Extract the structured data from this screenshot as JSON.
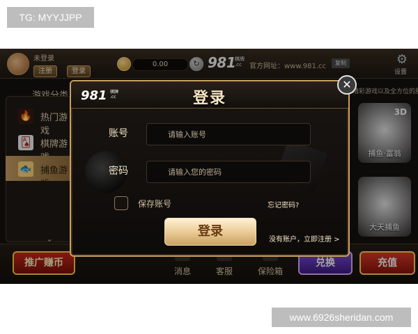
{
  "watermarks": {
    "top": "TG: MYYJJPP",
    "bottom": "www.6926sheridan.com"
  },
  "header": {
    "user_status": "未登录",
    "register_label": "注册",
    "login_label": "登录",
    "balance": "0.00",
    "refresh_symbol": "↻",
    "brand": "981",
    "brand_sub": "棋牌\n.cc",
    "site_label": "官方网址：www.981.cc",
    "copy_label": "复制",
    "settings_label": "设置",
    "settings_icon": "⚙"
  },
  "sidebar": {
    "title": "游戏分类",
    "items": [
      {
        "label": "热门游戏",
        "icon": "🔥"
      },
      {
        "label": "棋牌游戏",
        "icon": "🂡"
      },
      {
        "label": "捕鱼游戏",
        "icon": "🐟"
      }
    ],
    "more_icon": "⌄"
  },
  "right": {
    "caption": "精彩游戏以及全方位的服务",
    "tiles": [
      {
        "label": "捕鱼·富翁",
        "badge": "3D"
      },
      {
        "label": "大天捕鱼",
        "badge": ""
      }
    ]
  },
  "bottom": {
    "promo": "推广赚币",
    "nav": [
      {
        "label": "消息"
      },
      {
        "label": "客服"
      },
      {
        "label": "保险箱"
      }
    ],
    "exchange": "兑换",
    "recharge": "充值"
  },
  "modal": {
    "brand": "981",
    "brand_sub": "棋牌\n.cc",
    "title": "登录",
    "close_symbol": "✕",
    "account_label": "账号",
    "account_placeholder": "请输入账号",
    "password_label": "密码",
    "password_placeholder": "请输入您的密码",
    "save_label": "保存账号",
    "forgot_label": "忘记密码?",
    "login_button": "登录",
    "register_link": "没有账户，立即注册 >"
  },
  "colors": {
    "gold": "#c9a063",
    "dark_bg": "#15110e",
    "promo_red": "#c8281c",
    "exchange_purple": "#7a4ad1"
  }
}
